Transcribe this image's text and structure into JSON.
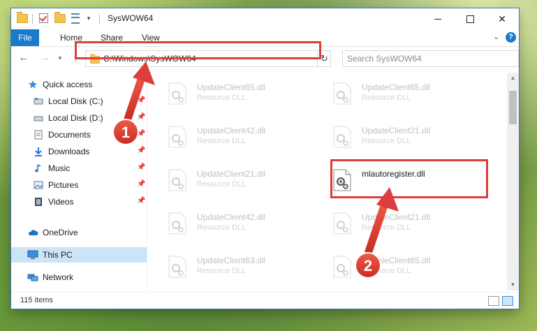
{
  "window": {
    "title": "SysWOW64",
    "quick_access_toolbar": [
      "folder-icon",
      "properties-check-icon",
      "new-folder-icon",
      "customize-icon"
    ]
  },
  "ribbon": {
    "tabs": [
      {
        "label": "File"
      },
      {
        "label": "Home"
      },
      {
        "label": "Share"
      },
      {
        "label": "View"
      }
    ],
    "help": "?"
  },
  "address": {
    "path": "C:\\Windows\\SysWOW64",
    "search_placeholder": "Search SysWOW64"
  },
  "nav_pane": {
    "items": [
      {
        "label": "Quick access"
      },
      {
        "label": "Local Disk (C:)"
      },
      {
        "label": "Local Disk (D:)"
      },
      {
        "label": "Documents"
      },
      {
        "label": "Downloads"
      },
      {
        "label": "Music"
      },
      {
        "label": "Pictures"
      },
      {
        "label": "Videos"
      },
      {
        "label": "OneDrive"
      },
      {
        "label": "This PC"
      },
      {
        "label": "Network"
      }
    ]
  },
  "files": [
    {
      "name": "UpdateClient65.dll",
      "desc": "Resource DLL"
    },
    {
      "name": "UpdateClient65.dll",
      "desc": "Resource DLL"
    },
    {
      "name": "UpdateClient42.dll",
      "desc": "Resource DLL"
    },
    {
      "name": "UpdateClient21.dll",
      "desc": "Resource DLL"
    },
    {
      "name": "UpdateClient21.dll",
      "desc": "Resource DLL"
    },
    {
      "name": "mlautoregister.dll",
      "desc": ""
    },
    {
      "name": "UpdateClient42.dll",
      "desc": "Resource DLL"
    },
    {
      "name": "UpdateClient21.dll",
      "desc": "Resource DLL"
    },
    {
      "name": "UpdateClient63.dll",
      "desc": "Resource DLL"
    },
    {
      "name": "UpdateClient65.dll",
      "desc": "Resource DLL"
    }
  ],
  "status": {
    "item_count": "115 items"
  },
  "annotations": {
    "step1": "1",
    "step2": "2",
    "highlight_color": "#dc3d3d"
  }
}
